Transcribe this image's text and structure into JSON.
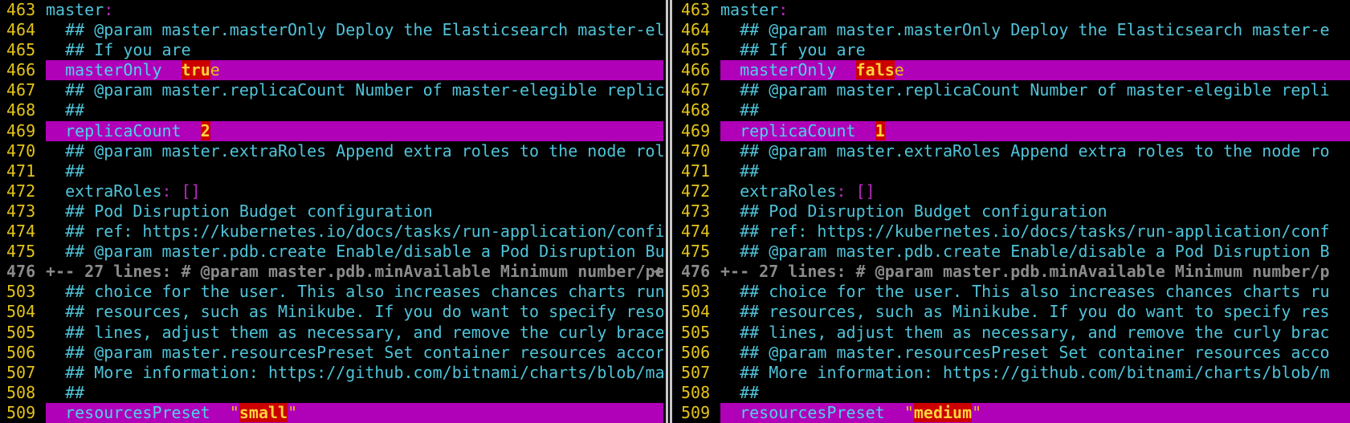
{
  "left": {
    "lines": [
      {
        "num": "463",
        "key": "master",
        "punct": ":"
      },
      {
        "num": "464",
        "comment": "  ## @param master.masterOnly Deploy the Elasticsearch master-el"
      },
      {
        "num": "465",
        "comment": "  ## If you are"
      },
      {
        "num": "466",
        "indent": "  ",
        "key": "masterOnly",
        "sep": "  ",
        "diff": "tru",
        "tail": "e"
      },
      {
        "num": "467",
        "comment": "  ## @param master.replicaCount Number of master-elegible replic"
      },
      {
        "num": "468",
        "comment": "  ##"
      },
      {
        "num": "469",
        "indent": "  ",
        "key": "replicaCount",
        "sep": "  ",
        "diff": "2",
        "tail": ""
      },
      {
        "num": "470",
        "comment": "  ## @param master.extraRoles Append extra roles to the node rol"
      },
      {
        "num": "471",
        "comment": "  ##"
      },
      {
        "num": "472",
        "indent": "  ",
        "key": "extraRoles",
        "punct": ": []"
      },
      {
        "num": "473",
        "comment": "  ## Pod Disruption Budget configuration"
      },
      {
        "num": "474",
        "comment": "  ## ref: https://kubernetes.io/docs/tasks/run-application/confi"
      },
      {
        "num": "475",
        "comment": "  ## @param master.pdb.create Enable/disable a Pod Disruption Bu"
      },
      {
        "num": "476",
        "fold": "+-- 27 lines: # @param master.pdb.minAvailable Minimum number/pe"
      },
      {
        "num": "503",
        "comment": "  ## choice for the user. This also increases chances charts run"
      },
      {
        "num": "504",
        "comment": "  ## resources, such as Minikube. If you do want to specify reso"
      },
      {
        "num": "505",
        "comment": "  ## lines, adjust them as necessary, and remove the curly brace"
      },
      {
        "num": "506",
        "comment": "  ## @param master.resourcesPreset Set container resources accor"
      },
      {
        "num": "507",
        "comment": "  ## More information: https://github.com/bitnami/charts/blob/ma"
      },
      {
        "num": "508",
        "comment": "  ##"
      },
      {
        "num": "509",
        "indent": "  ",
        "key": "resourcesPreset",
        "sep": "  ",
        "q1": "\"",
        "diff": "small",
        "q2": "\""
      }
    ]
  },
  "right": {
    "lines": [
      {
        "num": "463",
        "key": "master",
        "punct": ":"
      },
      {
        "num": "464",
        "comment": "  ## @param master.masterOnly Deploy the Elasticsearch master-e"
      },
      {
        "num": "465",
        "comment": "  ## If you are"
      },
      {
        "num": "466",
        "indent": "  ",
        "key": "masterOnly",
        "sep": "  ",
        "diff": "fals",
        "tail": "e"
      },
      {
        "num": "467",
        "comment": "  ## @param master.replicaCount Number of master-elegible repli"
      },
      {
        "num": "468",
        "comment": "  ##"
      },
      {
        "num": "469",
        "indent": "  ",
        "key": "replicaCount",
        "sep": "  ",
        "diff": "1",
        "tail": ""
      },
      {
        "num": "470",
        "comment": "  ## @param master.extraRoles Append extra roles to the node ro"
      },
      {
        "num": "471",
        "comment": "  ##"
      },
      {
        "num": "472",
        "indent": "  ",
        "key": "extraRoles",
        "punct": ": []"
      },
      {
        "num": "473",
        "comment": "  ## Pod Disruption Budget configuration"
      },
      {
        "num": "474",
        "comment": "  ## ref: https://kubernetes.io/docs/tasks/run-application/conf"
      },
      {
        "num": "475",
        "comment": "  ## @param master.pdb.create Enable/disable a Pod Disruption B"
      },
      {
        "num": "476",
        "fold": "+-- 27 lines: # @param master.pdb.minAvailable Minimum number/p"
      },
      {
        "num": "503",
        "comment": "  ## choice for the user. This also increases chances charts ru"
      },
      {
        "num": "504",
        "comment": "  ## resources, such as Minikube. If you do want to specify res"
      },
      {
        "num": "505",
        "comment": "  ## lines, adjust them as necessary, and remove the curly brac"
      },
      {
        "num": "506",
        "comment": "  ## @param master.resourcesPreset Set container resources acco"
      },
      {
        "num": "507",
        "comment": "  ## More information: https://github.com/bitnami/charts/blob/m"
      },
      {
        "num": "508",
        "comment": "  ##"
      },
      {
        "num": "509",
        "indent": "  ",
        "key": "resourcesPreset",
        "sep": "  ",
        "q1": "\"",
        "diff": "medium",
        "q2": "\""
      }
    ]
  },
  "fold_marker": "+",
  "colors": {
    "background": "#000000",
    "line_number": "#e4c418",
    "text": "#4fc3d9",
    "changed_line": "#b000b8",
    "changed_text": "#cc0000",
    "fold": "#8a8a8a"
  }
}
